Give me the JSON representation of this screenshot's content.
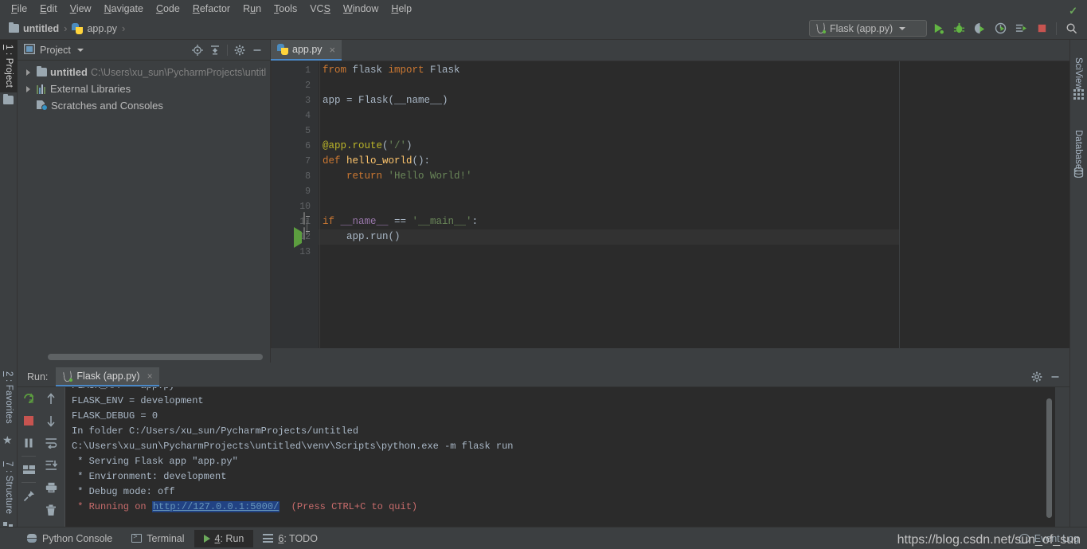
{
  "menu": {
    "items": [
      "File",
      "Edit",
      "View",
      "Navigate",
      "Code",
      "Refactor",
      "Run",
      "Tools",
      "VCS",
      "Window",
      "Help"
    ]
  },
  "breadcrumb": {
    "project": "untitled",
    "file": "app.py",
    "separator": "›"
  },
  "toolbar": {
    "run_config": "Flask (app.py)",
    "icons": [
      "run-icon",
      "debug-icon",
      "run-coverage-icon",
      "profile-icon",
      "run-with-console-icon",
      "stop-icon",
      "search-everywhere-icon"
    ]
  },
  "left_strip": {
    "tabs": [
      {
        "num": "1",
        "label": ": Project",
        "icon": "project-folder-icon",
        "active": true
      },
      {
        "num": "2",
        "label": ": Favorites",
        "icon": "star-icon",
        "active": false
      },
      {
        "num": "7",
        "label": ": Structure",
        "icon": "structure-icon",
        "active": false
      }
    ]
  },
  "right_strip": {
    "tabs": [
      {
        "label": "SciView",
        "icon": "grid-icon"
      },
      {
        "label": "Database",
        "icon": "database-icon"
      }
    ]
  },
  "project_panel": {
    "title": "Project",
    "header_icons": [
      "locate-icon",
      "collapse-all-icon",
      "settings-gear-icon",
      "minimize-icon"
    ],
    "tree": [
      {
        "label": "untitled",
        "path": "C:\\Users\\xu_sun\\PycharmProjects\\untitl",
        "icon": "folder-icon",
        "arrow": true,
        "bold": true
      },
      {
        "label": "External Libraries",
        "path": "",
        "icon": "library-icon",
        "arrow": true,
        "bold": false
      },
      {
        "label": "Scratches and Consoles",
        "path": "",
        "icon": "scratches-icon",
        "arrow": false,
        "bold": false
      }
    ]
  },
  "editor": {
    "tab": {
      "label": "app.py",
      "icon": "python-file-icon",
      "close": "×"
    },
    "inspection_status": "✓",
    "line_numbers": [
      "1",
      "2",
      "3",
      "4",
      "5",
      "6",
      "7",
      "8",
      "9",
      "10",
      "11",
      "12",
      "13"
    ],
    "code_lines": [
      {
        "n": 1,
        "tokens": [
          {
            "t": "from",
            "c": "kw"
          },
          {
            "t": " flask ",
            "c": "id"
          },
          {
            "t": "import",
            "c": "kw"
          },
          {
            "t": " Flask",
            "c": "cls"
          }
        ]
      },
      {
        "n": 2,
        "tokens": []
      },
      {
        "n": 3,
        "tokens": [
          {
            "t": "app = Flask(",
            "c": "id"
          },
          {
            "t": "__name__",
            "c": "id"
          },
          {
            "t": ")",
            "c": "id"
          }
        ]
      },
      {
        "n": 4,
        "tokens": []
      },
      {
        "n": 5,
        "tokens": []
      },
      {
        "n": 6,
        "tokens": [
          {
            "t": "@app.route",
            "c": "dec"
          },
          {
            "t": "(",
            "c": "id"
          },
          {
            "t": "'/'",
            "c": "str"
          },
          {
            "t": ")",
            "c": "id"
          }
        ]
      },
      {
        "n": 7,
        "tokens": [
          {
            "t": "def ",
            "c": "kw"
          },
          {
            "t": "hello_world",
            "c": "fn"
          },
          {
            "t": "():",
            "c": "id"
          }
        ]
      },
      {
        "n": 8,
        "tokens": [
          {
            "t": "    return ",
            "c": "kw"
          },
          {
            "t": "'Hello World!'",
            "c": "str"
          }
        ]
      },
      {
        "n": 9,
        "tokens": []
      },
      {
        "n": 10,
        "tokens": []
      },
      {
        "n": 11,
        "tokens": [
          {
            "t": "if ",
            "c": "kw"
          },
          {
            "t": "__name__",
            "c": "mag"
          },
          {
            "t": " == ",
            "c": "id"
          },
          {
            "t": "'__main__'",
            "c": "str"
          },
          {
            "t": ":",
            "c": "id"
          }
        ]
      },
      {
        "n": 12,
        "tokens": [
          {
            "t": "    app.run()",
            "c": "id"
          }
        ]
      },
      {
        "n": 13,
        "tokens": []
      }
    ]
  },
  "run_panel": {
    "label": "Run:",
    "tab": {
      "label": "Flask (app.py)",
      "icon": "flask-icon",
      "close": "×"
    },
    "header_icons": [
      "settings-gear-icon",
      "minimize-icon"
    ],
    "side_icons_left": [
      "rerun-icon",
      "stop-icon",
      "pause-icon",
      "layout-icon",
      "pin-icon"
    ],
    "side_icons_right": [
      "up-arrow-icon",
      "down-arrow-icon",
      "soft-wrap-icon",
      "scroll-to-end-icon",
      "print-icon",
      "trash-icon"
    ],
    "console_lines": [
      {
        "text": "FLASK_ENV = development",
        "style": "normal"
      },
      {
        "text": "FLASK_DEBUG = 0",
        "style": "normal"
      },
      {
        "text": "In folder C:/Users/xu_sun/PycharmProjects/untitled",
        "style": "normal"
      },
      {
        "text": "C:\\Users\\xu_sun\\PycharmProjects\\untitled\\venv\\Scripts\\python.exe -m flask run",
        "style": "normal"
      },
      {
        "text": " * Serving Flask app \"app.py\"",
        "style": "normal"
      },
      {
        "text": " * Environment: development",
        "style": "normal"
      },
      {
        "text": " * Debug mode: off",
        "style": "normal"
      }
    ],
    "running_line": {
      "prefix": " * Running on ",
      "link": "http://127.0.0.1:5000/",
      "suffix": "  (Press CTRL+C to quit)"
    }
  },
  "status_bar": {
    "items": [
      {
        "label": "Python Console",
        "num": "",
        "icon": "python-console-icon",
        "active": false
      },
      {
        "label": "Terminal",
        "num": "",
        "icon": "terminal-icon",
        "active": false
      },
      {
        "label": ": Run",
        "num": "4",
        "icon": "run-play-icon",
        "active": true
      },
      {
        "label": ": TODO",
        "num": "6",
        "icon": "todo-icon",
        "active": false
      }
    ],
    "event_log": "Event Log"
  },
  "watermark": "https://blog.csdn.net/sun_of_sun",
  "colors": {
    "chrome_bg": "#3C3F41",
    "editor_bg": "#2B2B2B",
    "gutter_bg": "#313335",
    "accent_tab": "#4A88C7",
    "keyword": "#CC7832",
    "string": "#6A8759",
    "function": "#FFC66D",
    "decorator": "#BBB529",
    "magic": "#9876AA",
    "error_text": "#C96C6C",
    "link_selection": "#214283",
    "run_green": "#62B543",
    "stop_red": "#C75450"
  }
}
